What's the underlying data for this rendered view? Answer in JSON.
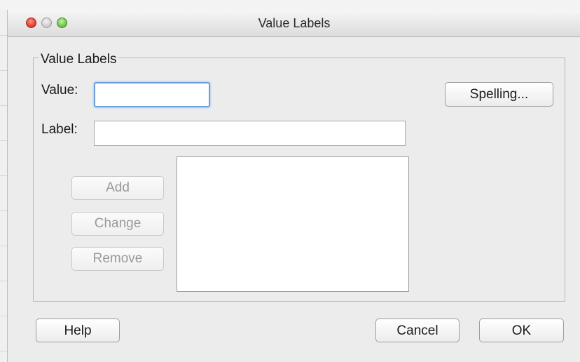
{
  "window": {
    "title": "Value Labels"
  },
  "group": {
    "legend": "Value Labels"
  },
  "fields": {
    "value_label": "Value:",
    "value_text": "",
    "label_label": "Label:",
    "label_text": ""
  },
  "buttons": {
    "spelling": "Spelling...",
    "add": "Add",
    "change": "Change",
    "remove": "Remove",
    "help": "Help",
    "cancel": "Cancel",
    "ok": "OK"
  },
  "labels_list": {
    "items": []
  }
}
